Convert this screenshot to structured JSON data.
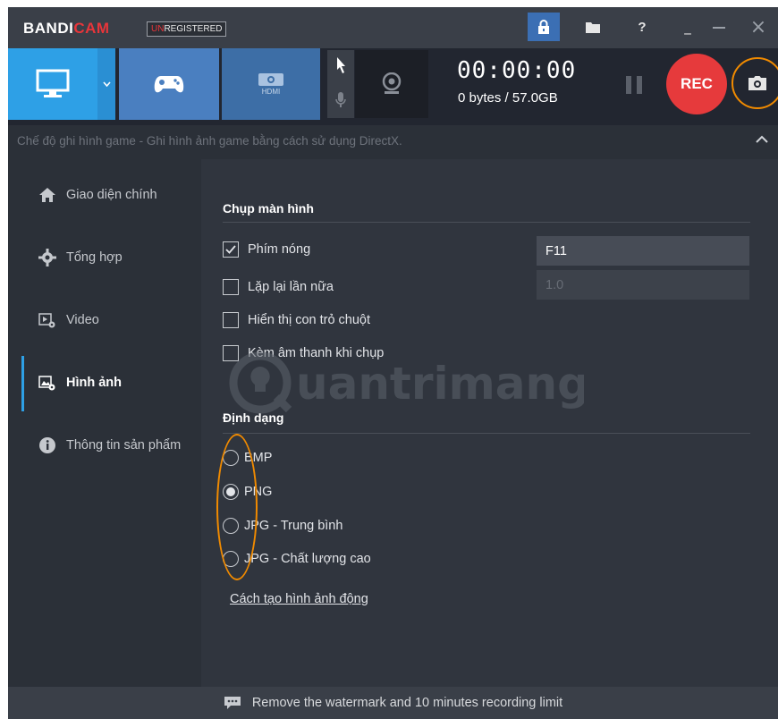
{
  "app": {
    "logo_part1": "BANDI",
    "logo_part2": "CAM",
    "unreg_part1": "UN",
    "unreg_part2": "REGISTERED"
  },
  "titlebar": {
    "help_label": "?",
    "minimize_label": "_",
    "close_label": "×"
  },
  "toolbar": {
    "hdmi_label": "HDMI",
    "timer": "00:00:00",
    "size": "0 bytes / 57.0GB",
    "rec_label": "REC"
  },
  "infobar": {
    "text": "Chế độ ghi hình game - Ghi hình ảnh game bằng cách sử dụng DirectX."
  },
  "sidebar": {
    "items": [
      {
        "label": "Giao diện chính",
        "icon": "home-icon"
      },
      {
        "label": "Tổng hợp",
        "icon": "gear-icon"
      },
      {
        "label": "Video",
        "icon": "video-settings-icon"
      },
      {
        "label": "Hình ảnh",
        "icon": "image-settings-icon",
        "active": true
      },
      {
        "label": "Thông tin sản phẩm",
        "icon": "info-icon"
      }
    ]
  },
  "capture": {
    "title": "Chụp màn hình",
    "hotkey_label": "Phím nóng",
    "hotkey_value": "F11",
    "hotkey_checked": true,
    "repeat_label": "Lặp lại lần nữa",
    "repeat_value": "1.0",
    "repeat_checked": false,
    "cursor_label": "Hiển thị con trỏ chuột",
    "cursor_checked": false,
    "sound_label": "Kèm âm thanh khi chụp",
    "sound_checked": false
  },
  "format": {
    "title": "Định dạng",
    "options": [
      "BMP",
      "PNG",
      "JPG - Trung bình",
      "JPG - Chất lượng cao"
    ],
    "selected": "PNG",
    "link": "Cách tạo hình ảnh động"
  },
  "watermark": {
    "text": "uantrimang"
  },
  "footer": {
    "text": "Remove the watermark and 10 minutes recording limit"
  },
  "colors": {
    "accent_blue": "#2ea0e6",
    "rec_red": "#e63a3c",
    "highlight_orange": "#f08a00"
  }
}
